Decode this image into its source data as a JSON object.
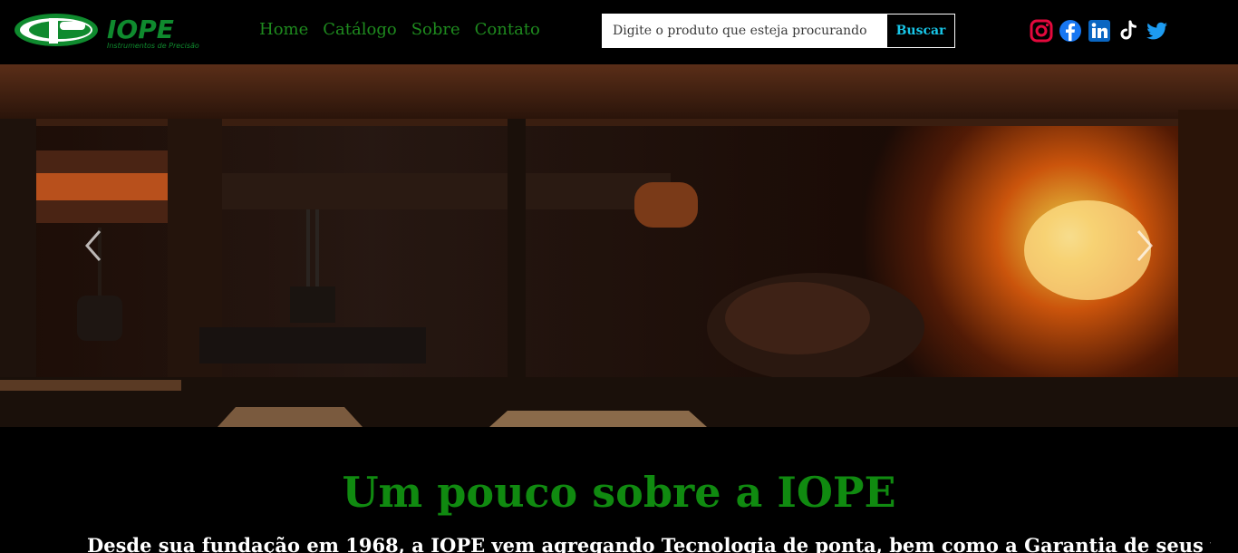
{
  "brand": {
    "name": "IOPE",
    "tagline": "Instrumentos de Precisão"
  },
  "nav": {
    "home": "Home",
    "catalog": "Catálogo",
    "about": "Sobre",
    "contact": "Contato"
  },
  "search": {
    "placeholder": "Digite o produto que esteja procurando",
    "button": "Buscar"
  },
  "social": [
    "instagram-icon",
    "facebook-icon",
    "linkedin-icon",
    "tiktok-icon",
    "twitter-icon"
  ],
  "hero": {
    "image": "steel-mill-photo",
    "controls": [
      "prev-arrow-icon",
      "next-arrow-icon"
    ]
  },
  "about": {
    "title": "Um pouco sobre a IOPE",
    "text": "Desde sua fundação em 1968, a IOPE vem agregando Tecnologia de ponta, bem como a Garantia de seus produtos e"
  },
  "colors": {
    "brand_green": "#108a10",
    "nav_green": "#1e8a1e",
    "button_text": "#18c6e8",
    "background": "#000000"
  }
}
